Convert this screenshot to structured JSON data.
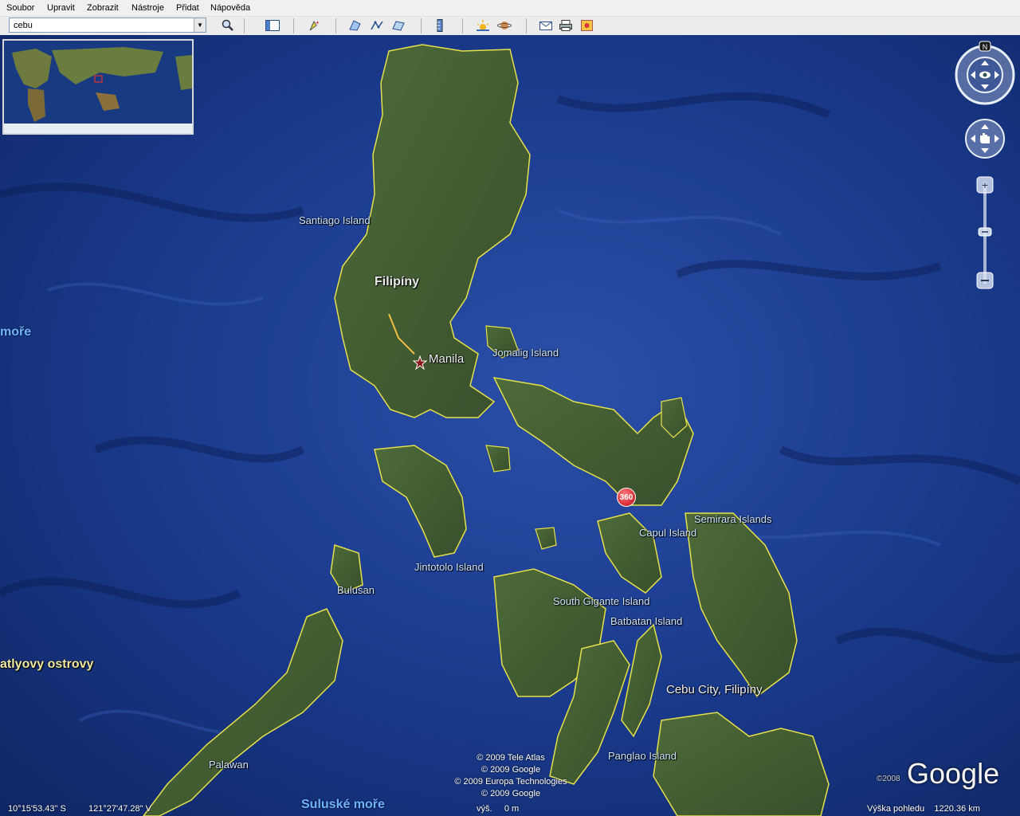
{
  "menu": {
    "items": [
      "Soubor",
      "Upravit",
      "Zobrazit",
      "Nástroje",
      "Přidat",
      "Nápověda"
    ]
  },
  "toolbar": {
    "search_value": "cebu",
    "icons": [
      "search-icon",
      "sidebar-toggle-icon",
      "placemark-icon",
      "polygon-icon",
      "path-icon",
      "image-overlay-icon",
      "ruler-icon",
      "sun-icon",
      "planets-icon",
      "email-icon",
      "print-icon",
      "maps-icon"
    ]
  },
  "map": {
    "labels": {
      "santiago": "Santiago Island",
      "filipiny": "Filipíny",
      "manila": "Manila",
      "jomalig": "Jomalig Island",
      "semirara": "Semirara Islands",
      "capul": "Capul Island",
      "jintotolo": "Jintotolo Island",
      "bulusan": "Bulusan",
      "south_gigante": "South Gigante Island",
      "batbatan": "Batbatan Island",
      "cebu_city": "Cebu City, Filipíny",
      "panglao": "Panglao Island",
      "palawan": "Palawan",
      "spratly": "atlyovy ostrovy",
      "sea_left": "moře",
      "sulu": "Suluské moře",
      "pin": "360"
    },
    "credits": [
      "© 2009 Tele Atlas",
      "© 2009 Google",
      "© 2009 Europa Technologies",
      "© 2009 Google"
    ],
    "logo": "Google",
    "logo_year": "©2008",
    "colors": {
      "water": "#163a8a",
      "land": "#3c5a2e",
      "border": "#e6e14a"
    }
  },
  "status": {
    "lat": "10°15'53.43\" S",
    "lon": "121°27'47.28\" V",
    "elev": "výš.     0 m",
    "view_alt": "Výška pohledu    1220.36 km"
  },
  "nav": {
    "north": "N"
  }
}
